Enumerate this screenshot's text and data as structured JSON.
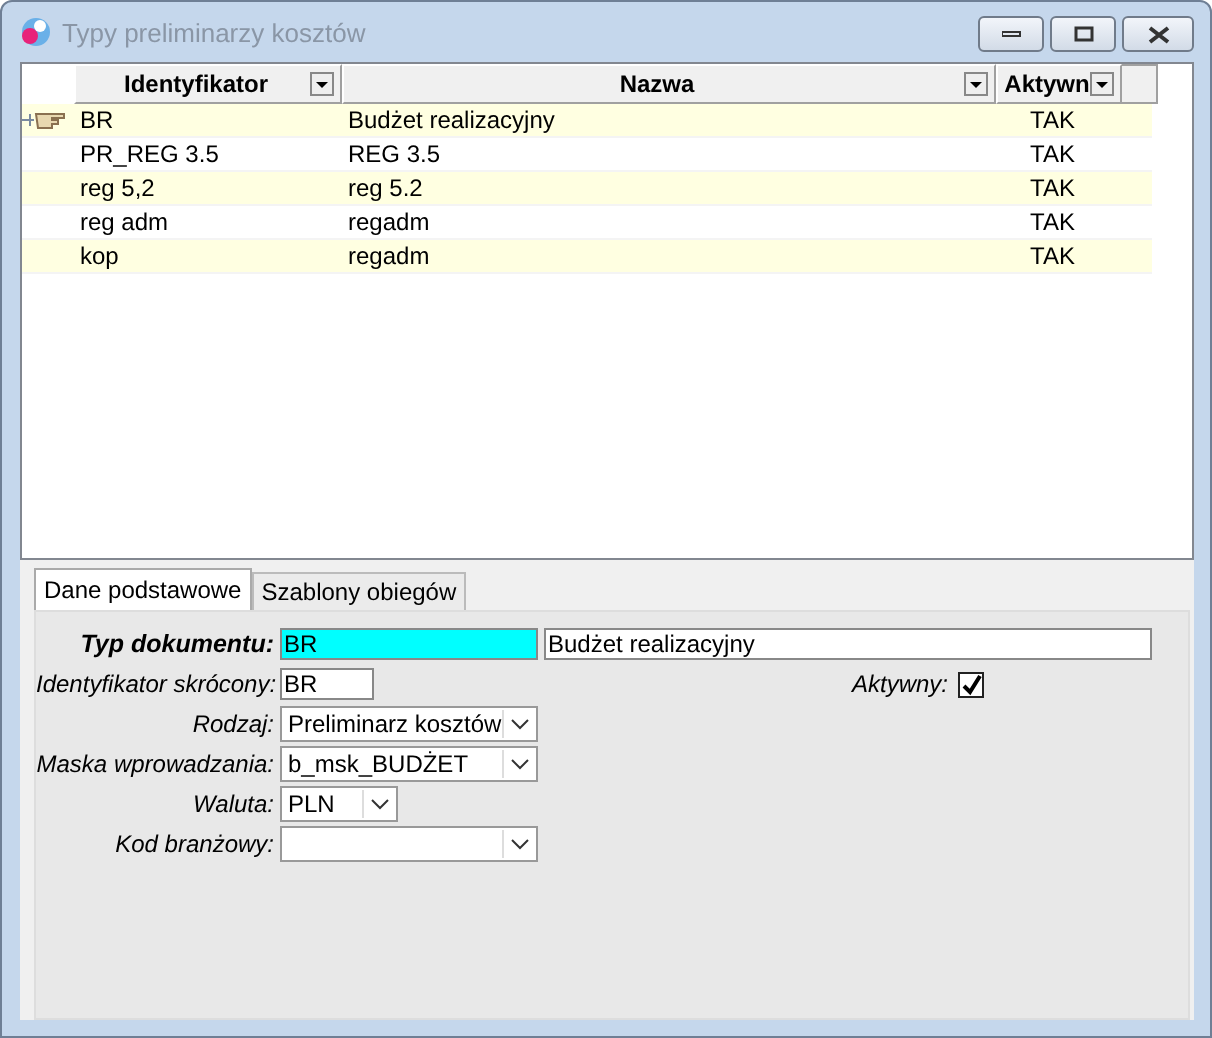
{
  "window": {
    "title": "Typy preliminarzy kosztów"
  },
  "table": {
    "columns": [
      "Identyfikator",
      "Nazwa",
      "Aktywn"
    ],
    "rows": [
      {
        "cells": [
          "BR",
          "Budżet realizacyjny",
          "TAK"
        ],
        "selected": true
      },
      {
        "cells": [
          "PR_REG 3.5",
          "REG 3.5",
          "TAK"
        ],
        "selected": false
      },
      {
        "cells": [
          "reg 5,2",
          "reg 5.2",
          "TAK"
        ],
        "selected": false
      },
      {
        "cells": [
          "reg adm",
          "regadm",
          "TAK"
        ],
        "selected": false
      },
      {
        "cells": [
          "kop",
          "regadm",
          "TAK"
        ],
        "selected": false
      }
    ]
  },
  "tabs": [
    {
      "label": "Dane podstawowe",
      "selected": true
    },
    {
      "label": "Szablony obiegów",
      "selected": false
    }
  ],
  "form": {
    "typ": {
      "label": "Typ dokumentu:",
      "value": "BR",
      "name": "Budżet realizacyjny"
    },
    "ident": {
      "label": "Identyfikator skrócony:",
      "value": "BR"
    },
    "aktywny": {
      "label": "Aktywny:",
      "checked": true
    },
    "combos": [
      {
        "label": "Rodzaj:",
        "value": "Preliminarz kosztów",
        "kind": "wide"
      },
      {
        "label": "Maska wprowadzania:",
        "value": "b_msk_BUDŻET",
        "kind": "wide"
      },
      {
        "label": "Waluta:",
        "value": "PLN",
        "kind": "narrow"
      },
      {
        "label": "Kod branżowy:",
        "kind": "wide"
      }
    ]
  }
}
